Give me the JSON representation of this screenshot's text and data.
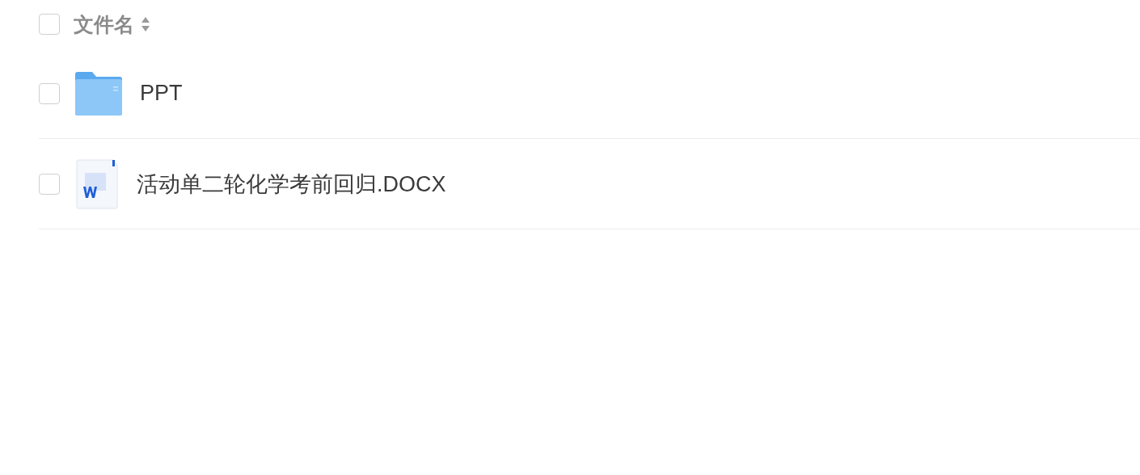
{
  "header": {
    "label": "文件名",
    "checked": false
  },
  "files": [
    {
      "kind": "folder",
      "name": "PPT",
      "checked": false
    },
    {
      "kind": "word",
      "name": "活动单二轮化学考前回归.DOCX",
      "checked": false
    }
  ]
}
